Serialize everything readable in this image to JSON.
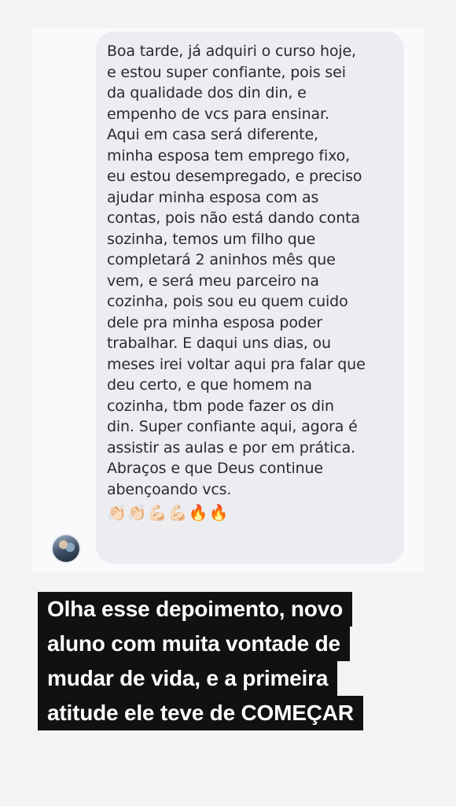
{
  "message": {
    "text": "Boa tarde, já adquiri o curso hoje,\ne estou super confiante, pois sei\nda qualidade dos din din, e\nempenho de vcs para ensinar.\nAqui em casa será diferente,\nminha esposa tem emprego fixo,\neu estou desempregado, e preciso\najudar minha esposa com as\ncontas, pois não está dando conta\nsozinha, temos um filho que\ncompletará 2 aninhos mês que\nvem, e será meu parceiro na\ncozinha, pois sou eu quem cuido\ndele pra minha esposa poder\ntrabalhar. E daqui uns dias, ou\nmeses irei voltar aqui pra falar que\ndeu certo, e que homem na\ncozinha, tbm pode fazer os din\ndin. Super confiante aqui, agora é\nassistir as aulas e por em prática.\nAbraços e que Deus continue\nabençoando vcs.",
    "reactions": "👏🏻👏🏻💪🏻💪🏻🔥🔥"
  },
  "avatar": {
    "icon": "profile-photo"
  },
  "caption": {
    "lines": [
      "Olha esse depoimento, novo",
      "aluno com muita vontade de",
      "mudar de vida, e a primeira",
      "atitude ele teve de COMEÇAR"
    ]
  }
}
